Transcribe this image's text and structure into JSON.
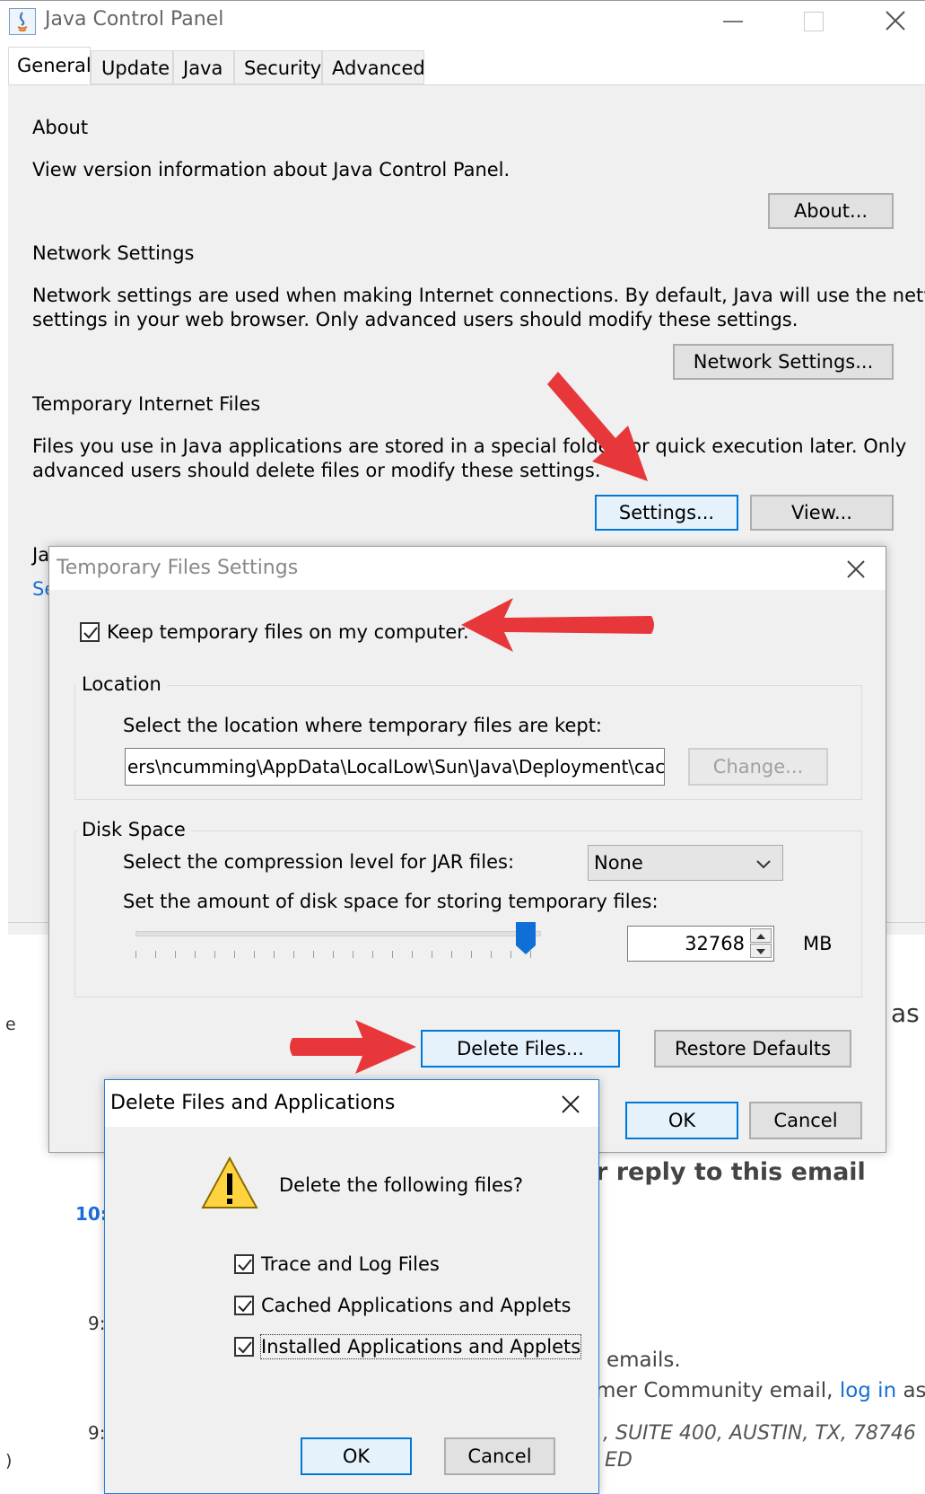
{
  "main_window": {
    "title": "Java Control Panel",
    "tabs": [
      "General",
      "Update",
      "Java",
      "Security",
      "Advanced"
    ],
    "about": {
      "heading": "About",
      "text": "View version information about Java Control Panel.",
      "button": "About..."
    },
    "network": {
      "heading": "Network Settings",
      "text_line1": "Network settings are used when making Internet connections. By default, Java will use the network",
      "text_line2": "settings in your web browser. Only advanced users should modify these settings.",
      "button": "Network Settings..."
    },
    "temp_files": {
      "heading": "Temporary Internet Files",
      "text_line1": "Files you use in Java applications are stored in a special folder for quick execution later. Only",
      "text_line2": "advanced users should delete files or modify these settings.",
      "settings_button": "Settings...",
      "view_button": "View..."
    },
    "partial_heading": "Ja",
    "partial_link": "Se"
  },
  "temp_settings_dialog": {
    "title": "Temporary Files Settings",
    "keep_files_label": "Keep temporary files on my computer.",
    "keep_files_checked": true,
    "location_group": "Location",
    "location_prompt": "Select the location where temporary files are kept:",
    "location_path": "ers\\ncumming\\AppData\\LocalLow\\Sun\\Java\\Deployment\\cache",
    "change_button": "Change...",
    "disk_space_group": "Disk Space",
    "compression_label": "Select the compression level for JAR files:",
    "compression_value": "None",
    "disk_amount_label": "Set the amount of disk space for storing temporary files:",
    "disk_amount_value": "32768",
    "disk_amount_unit": "MB",
    "slider_fraction": 0.8,
    "delete_button": "Delete Files...",
    "restore_button": "Restore Defaults",
    "ok_button": "OK",
    "cancel_button": "Cancel"
  },
  "delete_dialog": {
    "title": "Delete Files and Applications",
    "question": "Delete the following files?",
    "options": [
      {
        "label": "Trace and Log Files",
        "checked": true
      },
      {
        "label": "Cached Applications and Applets",
        "checked": true
      },
      {
        "label": "Installed Applications and Applets",
        "checked": true
      }
    ],
    "ok_button": "OK",
    "cancel_button": "Cancel"
  },
  "background": {
    "reply_text": "r reply to this email",
    "as_text": "as",
    "e_text": "e",
    "time1": "10:",
    "time2": "9:",
    "time3": "9:",
    "emails_text": "emails.",
    "community_text": "mer Community email, ",
    "login_text": "log in",
    "as_em_text": " as em",
    "address_text": ", SUITE 400, AUSTIN, TX, 78746 ",
    "ved_text": "ED",
    "paren_text": ")"
  },
  "colors": {
    "arrow": "#e8373a",
    "link": "#1a6dd6",
    "focus_border": "#0078d7",
    "panel_bg": "#f0f0f0"
  }
}
